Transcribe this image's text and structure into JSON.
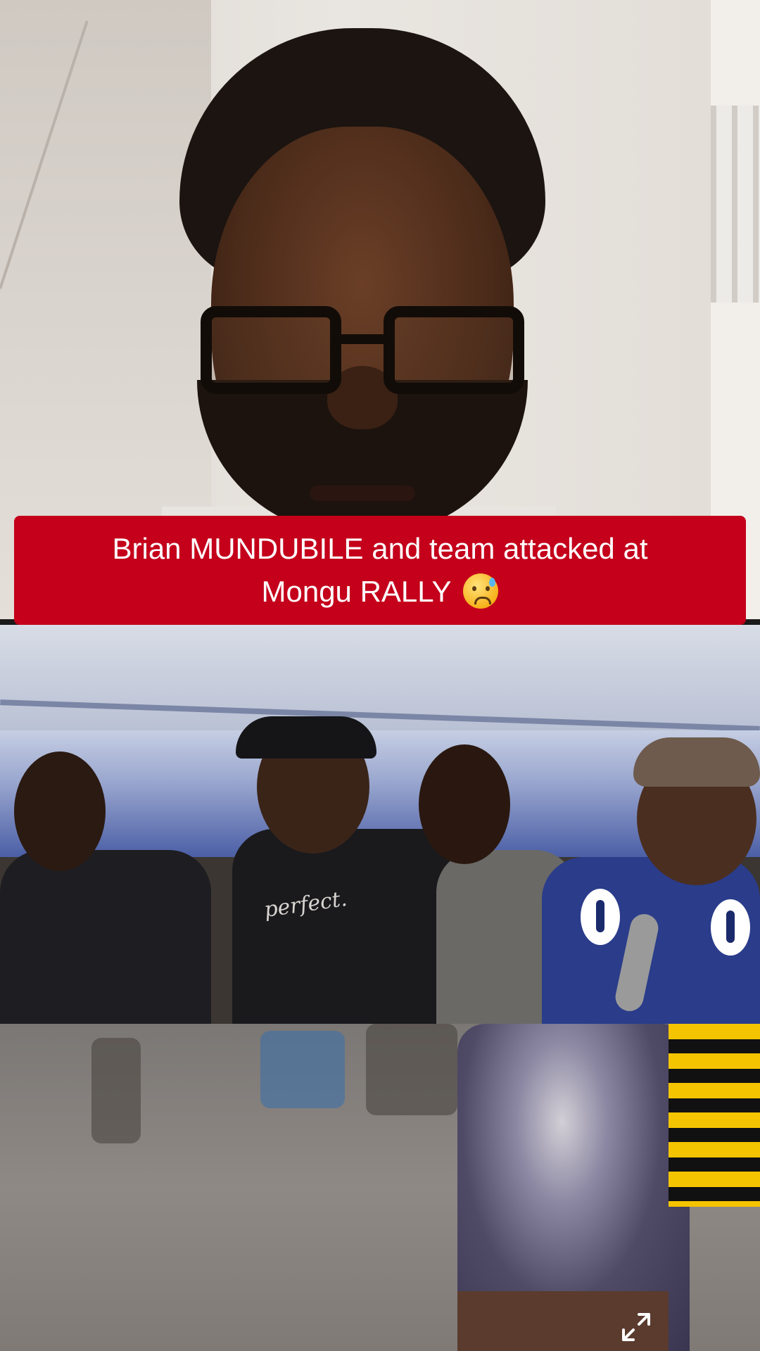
{
  "caption": {
    "line1": "Brian MUNDUBILE and team attacked at",
    "line2": "Mongu RALLY",
    "emoji": "sad-tear-emoji",
    "background_color": "#c4001b",
    "text_color": "#ffffff"
  },
  "video": {
    "shirt_print": "perfect.",
    "fullscreen_icon": "expand-arrows-icon"
  }
}
